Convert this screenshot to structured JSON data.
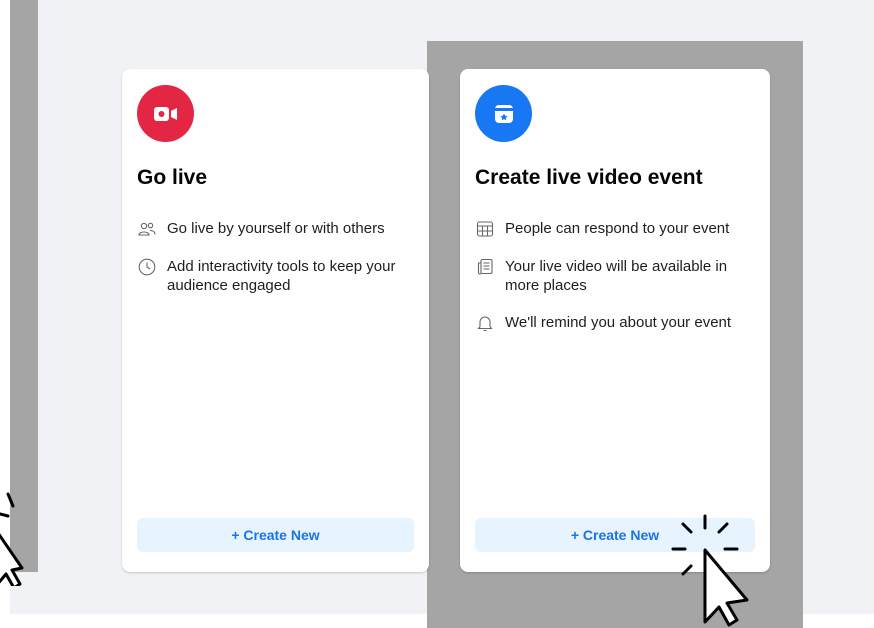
{
  "cards": [
    {
      "title": "Go live",
      "badge_icon": "video-camera-icon",
      "badge_color": "#e42645",
      "features": [
        {
          "icon": "people-icon",
          "text": "Go live by yourself or with others"
        },
        {
          "icon": "clock-icon",
          "text": "Add interactivity tools to keep your audience engaged"
        }
      ],
      "button_label": "+ Create New"
    },
    {
      "title": "Create live video event",
      "badge_icon": "calendar-star-icon",
      "badge_color": "#1877f2",
      "features": [
        {
          "icon": "calendar-grid-icon",
          "text": "People can respond to your event"
        },
        {
          "icon": "newsfeed-icon",
          "text": "Your live video will be available in more places"
        },
        {
          "icon": "bell-icon",
          "text": "We'll remind you about your event"
        }
      ],
      "button_label": "+ Create New"
    }
  ],
  "colors": {
    "background": "#f0f2f5",
    "highlight_frame": "#a5a5a5",
    "button_bg": "#e7f3ff",
    "button_text": "#1b74e4"
  }
}
